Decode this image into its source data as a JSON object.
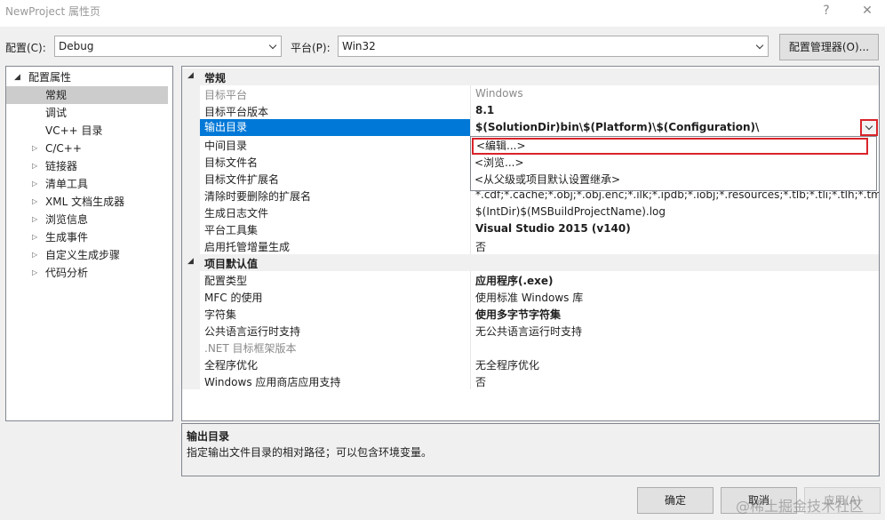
{
  "window": {
    "title": "NewProject 属性页",
    "help": "?",
    "close": "✕"
  },
  "config": {
    "config_label": "配置(C):",
    "config_value": "Debug",
    "platform_label": "平台(P):",
    "platform_value": "Win32",
    "manager_button": "配置管理器(O)..."
  },
  "tree": {
    "root": "配置属性",
    "items": [
      {
        "label": "常规",
        "selected": true,
        "expandable": false
      },
      {
        "label": "调试",
        "expandable": false
      },
      {
        "label": "VC++ 目录",
        "expandable": false
      },
      {
        "label": "C/C++",
        "expandable": true
      },
      {
        "label": "链接器",
        "expandable": true
      },
      {
        "label": "清单工具",
        "expandable": true
      },
      {
        "label": "XML 文档生成器",
        "expandable": true
      },
      {
        "label": "浏览信息",
        "expandable": true
      },
      {
        "label": "生成事件",
        "expandable": true
      },
      {
        "label": "自定义生成步骤",
        "expandable": true
      },
      {
        "label": "代码分析",
        "expandable": true
      }
    ]
  },
  "grid": {
    "cat_general": "常规",
    "general": [
      {
        "name": "目标平台",
        "value": "Windows",
        "gray": true
      },
      {
        "name": "目标平台版本",
        "value": "8.1",
        "bold": true
      },
      {
        "name": "输出目录",
        "value": "$(SolutionDir)bin\\$(Platform)\\$(Configuration)\\",
        "selected": true
      },
      {
        "name": "中间目录",
        "value": ""
      },
      {
        "name": "目标文件名",
        "value": ""
      },
      {
        "name": "目标文件扩展名",
        "value": ""
      },
      {
        "name": "清除时要删除的扩展名",
        "value": "*.cdf;*.cache;*.obj;*.obj.enc;*.ilk;*.ipdb;*.iobj;*.resources;*.tlb;*.tli;*.tlh;*.tmp;*.rsp"
      },
      {
        "name": "生成日志文件",
        "value": "$(IntDir)$(MSBuildProjectName).log"
      },
      {
        "name": "平台工具集",
        "value": "Visual Studio 2015 (v140)",
        "bold": true
      },
      {
        "name": "启用托管增量生成",
        "value": "否"
      }
    ],
    "cat_defaults": "项目默认值",
    "defaults": [
      {
        "name": "配置类型",
        "value": "应用程序(.exe)",
        "bold": true
      },
      {
        "name": "MFC 的使用",
        "value": "使用标准 Windows 库"
      },
      {
        "name": "字符集",
        "value": "使用多字节字符集",
        "bold": true
      },
      {
        "name": "公共语言运行时支持",
        "value": "无公共语言运行时支持"
      },
      {
        "name": ".NET 目标框架版本",
        "value": "",
        "gray": true
      },
      {
        "name": "全程序优化",
        "value": "无全程序优化"
      },
      {
        "name": "Windows 应用商店应用支持",
        "value": "否"
      }
    ]
  },
  "dropdown": {
    "options": [
      "<编辑...>",
      "<浏览...>",
      "<从父级或项目默认设置继承>"
    ]
  },
  "description": {
    "title": "输出目录",
    "text": "指定输出文件目录的相对路径；可以包含环境变量。"
  },
  "buttons": {
    "ok": "确定",
    "cancel": "取消",
    "apply": "应用(A)"
  },
  "watermark": "@稀土掘金技术社区",
  "colors": {
    "selection": "#0078d7",
    "highlight_border": "#d9242a",
    "tree_selection": "#cccccc"
  }
}
